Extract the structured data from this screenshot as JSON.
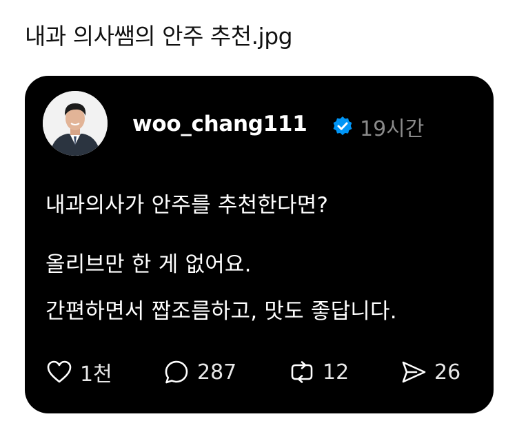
{
  "page": {
    "title": "내과 의사쌤의 안주 추천.jpg"
  },
  "post": {
    "username": "woo_chang111",
    "verified_icon": "verified-badge-icon",
    "time_ago": "19시간",
    "lines": [
      "내과의사가 안주를 추천한다면?",
      "올리브만 한 게 없어요.",
      "간편하면서 짭조름하고, 맛도 좋답니다."
    ],
    "actions": {
      "likes": "1천",
      "comments": "287",
      "reposts": "12",
      "shares": "26"
    }
  },
  "colors": {
    "card_background": "#000000",
    "verified_blue": "#0095f6",
    "time_gray": "#8a8a8a"
  }
}
